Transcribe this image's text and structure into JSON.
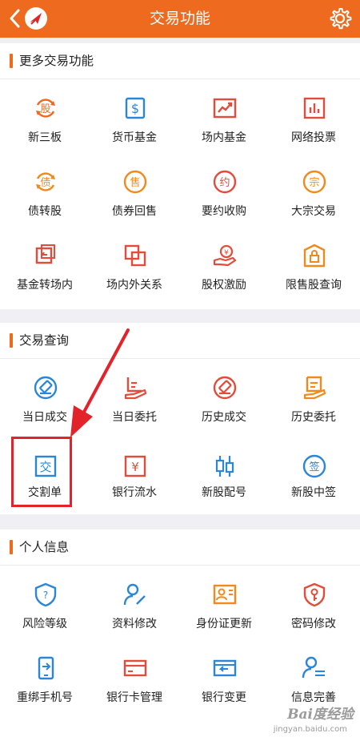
{
  "header": {
    "title": "交易功能"
  },
  "colors": {
    "accent": "#ee6a1e",
    "blue": "#2c86d6",
    "highlight": "#e2232a"
  },
  "sections": [
    {
      "title": "更多交易功能",
      "items": [
        {
          "label": "新三板",
          "icon": "stock-exchange-icon"
        },
        {
          "label": "货币基金",
          "icon": "dollar-icon"
        },
        {
          "label": "场内基金",
          "icon": "trend-chart-icon"
        },
        {
          "label": "网络投票",
          "icon": "bar-chart-icon"
        },
        {
          "label": "债转股",
          "icon": "bond-icon"
        },
        {
          "label": "债券回售",
          "icon": "sell-icon"
        },
        {
          "label": "要约收购",
          "icon": "offer-icon"
        },
        {
          "label": "大宗交易",
          "icon": "bulk-trade-icon"
        },
        {
          "label": "基金转场内",
          "icon": "transfer-icon"
        },
        {
          "label": "场内外关系",
          "icon": "relation-icon"
        },
        {
          "label": "股权激励",
          "icon": "equity-incentive-icon"
        },
        {
          "label": "限售股查询",
          "icon": "lock-icon"
        }
      ]
    },
    {
      "title": "交易查询",
      "items": [
        {
          "label": "当日成交",
          "icon": "deal-icon"
        },
        {
          "label": "当日委托",
          "icon": "order-icon"
        },
        {
          "label": "历史成交",
          "icon": "history-deal-icon"
        },
        {
          "label": "历史委托",
          "icon": "history-order-icon"
        },
        {
          "label": "交割单",
          "icon": "delivery-note-icon"
        },
        {
          "label": "银行流水",
          "icon": "bank-statement-icon"
        },
        {
          "label": "新股配号",
          "icon": "candlestick-icon"
        },
        {
          "label": "新股中签",
          "icon": "lottery-icon"
        }
      ]
    },
    {
      "title": "个人信息",
      "items": [
        {
          "label": "风险等级",
          "icon": "shield-icon"
        },
        {
          "label": "资料修改",
          "icon": "user-edit-icon"
        },
        {
          "label": "身份证更新",
          "icon": "id-card-icon"
        },
        {
          "label": "密码修改",
          "icon": "key-icon"
        },
        {
          "label": "重绑手机号",
          "icon": "phone-icon"
        },
        {
          "label": "银行卡管理",
          "icon": "bank-card-icon"
        },
        {
          "label": "银行变更",
          "icon": "bank-change-icon"
        },
        {
          "label": "信息完善",
          "icon": "user-info-icon"
        }
      ]
    }
  ],
  "watermark": {
    "text": "Bai度经验",
    "sub": "jingyan.baidu.com"
  }
}
